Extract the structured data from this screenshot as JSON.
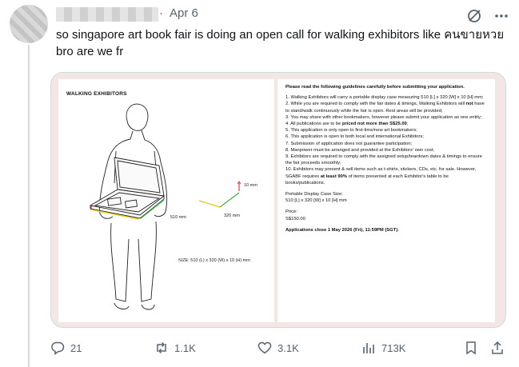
{
  "post": {
    "date": "Apr 6",
    "separator": "·",
    "text": "so singapore art book fair is doing an open call for walking exhibitors like คนขายหวย bro are we fr"
  },
  "image": {
    "left": {
      "title": "WALKING EXHIBITORS",
      "dim_height": "10 mm",
      "dim_length": "510 mm",
      "dim_width": "320 mm",
      "size_note": "SIZE: 510 (L) x 320 (W) x 10 (H) mm"
    },
    "right": {
      "heading": "Please read the following guidelines carefully before submitting your application.",
      "item1": "1. Walking Exhibitors will carry a portable display case measuring 510 [L] x 320 [W] x 10 [H] mm;",
      "item2_a": "2. While you are required to comply with the fair dates & timings, Walking Exhibitors will ",
      "item2_b": "not",
      "item2_c": " have to stand/walk continuously while the fair is open. Rest areas will be provided;",
      "item3": "3. You may share with other bookmakers, however please submit your application as one entity;",
      "item4_a": "4. All publications are to be ",
      "item4_b": "priced not more than S$25.00",
      "item4_c": ";",
      "item5": "5. This application is only open to first-time/new art bookmakers;",
      "item6": "6. This application is open to both local and international Exhibitors;",
      "item7": "7. Submission of application does not guarantee participation;",
      "item8": "8. Manpower must be arranged and provided at the Exhibitors' own cost;",
      "item9": "9. Exhibitors are required to comply with the assigned setup/teardown dates & timings to ensure the fair proceeds smoothly;",
      "item10_a": "10. Exhibitors may present & sell items such as t-shirts, stickers, CDs, etc. for sale. However, SGABF requires ",
      "item10_b": "at least 90%",
      "item10_c": " of items presented at each Exhibitor's table to be books/publications.",
      "case_label": "Portable Display Case Size:",
      "case_value": "510 [L] x 320 [W] x 10 [H] mm",
      "price_label": "Price:",
      "price_value": "S$150.00",
      "deadline": "Applications close 1 May 2026 (Fri), 11:59PM (SGT)."
    }
  },
  "actions": {
    "replies": "21",
    "reposts": "1.1K",
    "likes": "3.1K",
    "views": "713K"
  },
  "colors": {
    "muted": "#536471",
    "border": "#cfd9de",
    "media_bg": "#f4e7e3"
  },
  "icons": [
    "grok-icon",
    "more-icon",
    "reply-icon",
    "repost-icon",
    "like-icon",
    "views-icon",
    "bookmark-icon",
    "share-icon"
  ]
}
